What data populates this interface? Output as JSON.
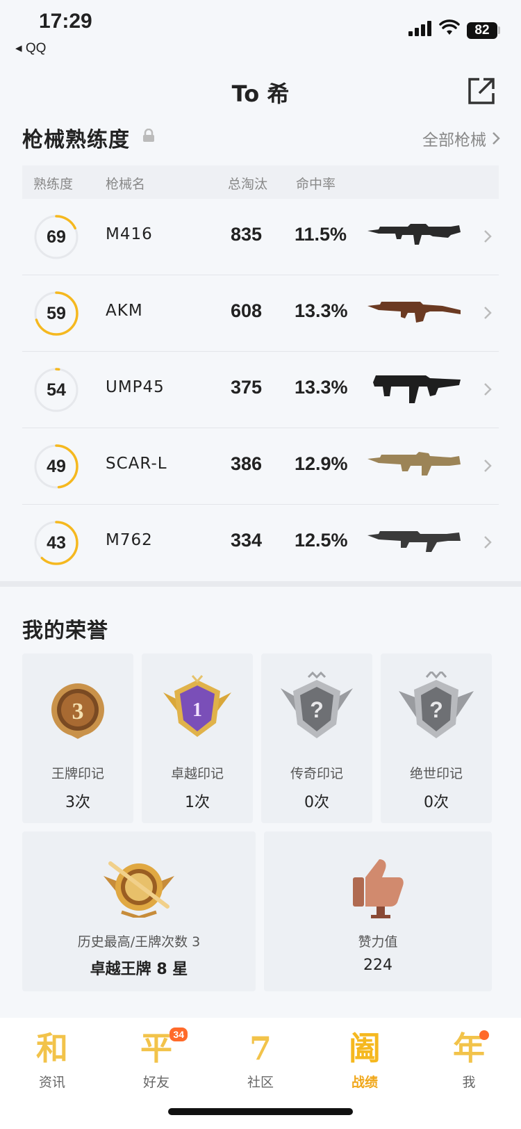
{
  "status": {
    "time": "17:29",
    "back_app": "◂ QQ",
    "battery": "82"
  },
  "header": {
    "title": "To 希"
  },
  "weapons": {
    "section_title": "枪械熟练度",
    "all_label": "全部枪械",
    "columns": [
      "熟练度",
      "枪械名",
      "总淘汰",
      "命中率"
    ],
    "rows": [
      {
        "level": "69",
        "progress": 0.18,
        "name": "M416",
        "kills": "835",
        "hit_rate": "11.5%",
        "gun_color": "#2a2a2a"
      },
      {
        "level": "59",
        "progress": 0.7,
        "name": "AKM",
        "kills": "608",
        "hit_rate": "13.3%",
        "gun_color": "#6b3a22"
      },
      {
        "level": "54",
        "progress": 0.02,
        "name": "UMP45",
        "kills": "375",
        "hit_rate": "13.3%",
        "gun_color": "#1e1e1e"
      },
      {
        "level": "49",
        "progress": 0.48,
        "name": "SCAR-L",
        "kills": "386",
        "hit_rate": "12.9%",
        "gun_color": "#9c8457"
      },
      {
        "level": "43",
        "progress": 0.62,
        "name": "M762",
        "kills": "334",
        "hit_rate": "12.5%",
        "gun_color": "#3a3a3a"
      }
    ]
  },
  "honors": {
    "section_title": "我的荣誉",
    "marks": [
      {
        "label": "王牌印记",
        "count": "3次"
      },
      {
        "label": "卓越印记",
        "count": "1次"
      },
      {
        "label": "传奇印记",
        "count": "0次"
      },
      {
        "label": "绝世印记",
        "count": "0次"
      }
    ],
    "highest": {
      "label": "历史最高/王牌次数 3",
      "value": "卓越王牌 8 星"
    },
    "likes": {
      "label": "赞力值",
      "value": "224"
    }
  },
  "tabs": [
    {
      "glyph": "和",
      "label": "资讯"
    },
    {
      "glyph": "平",
      "label": "好友",
      "badge": "34"
    },
    {
      "glyph": "7",
      "label": "社区"
    },
    {
      "glyph": "阖",
      "label": "战绩"
    },
    {
      "glyph": "年",
      "label": "我"
    }
  ],
  "colors": {
    "accent": "#f5b81f",
    "ring_track": "#e6e8ec"
  }
}
